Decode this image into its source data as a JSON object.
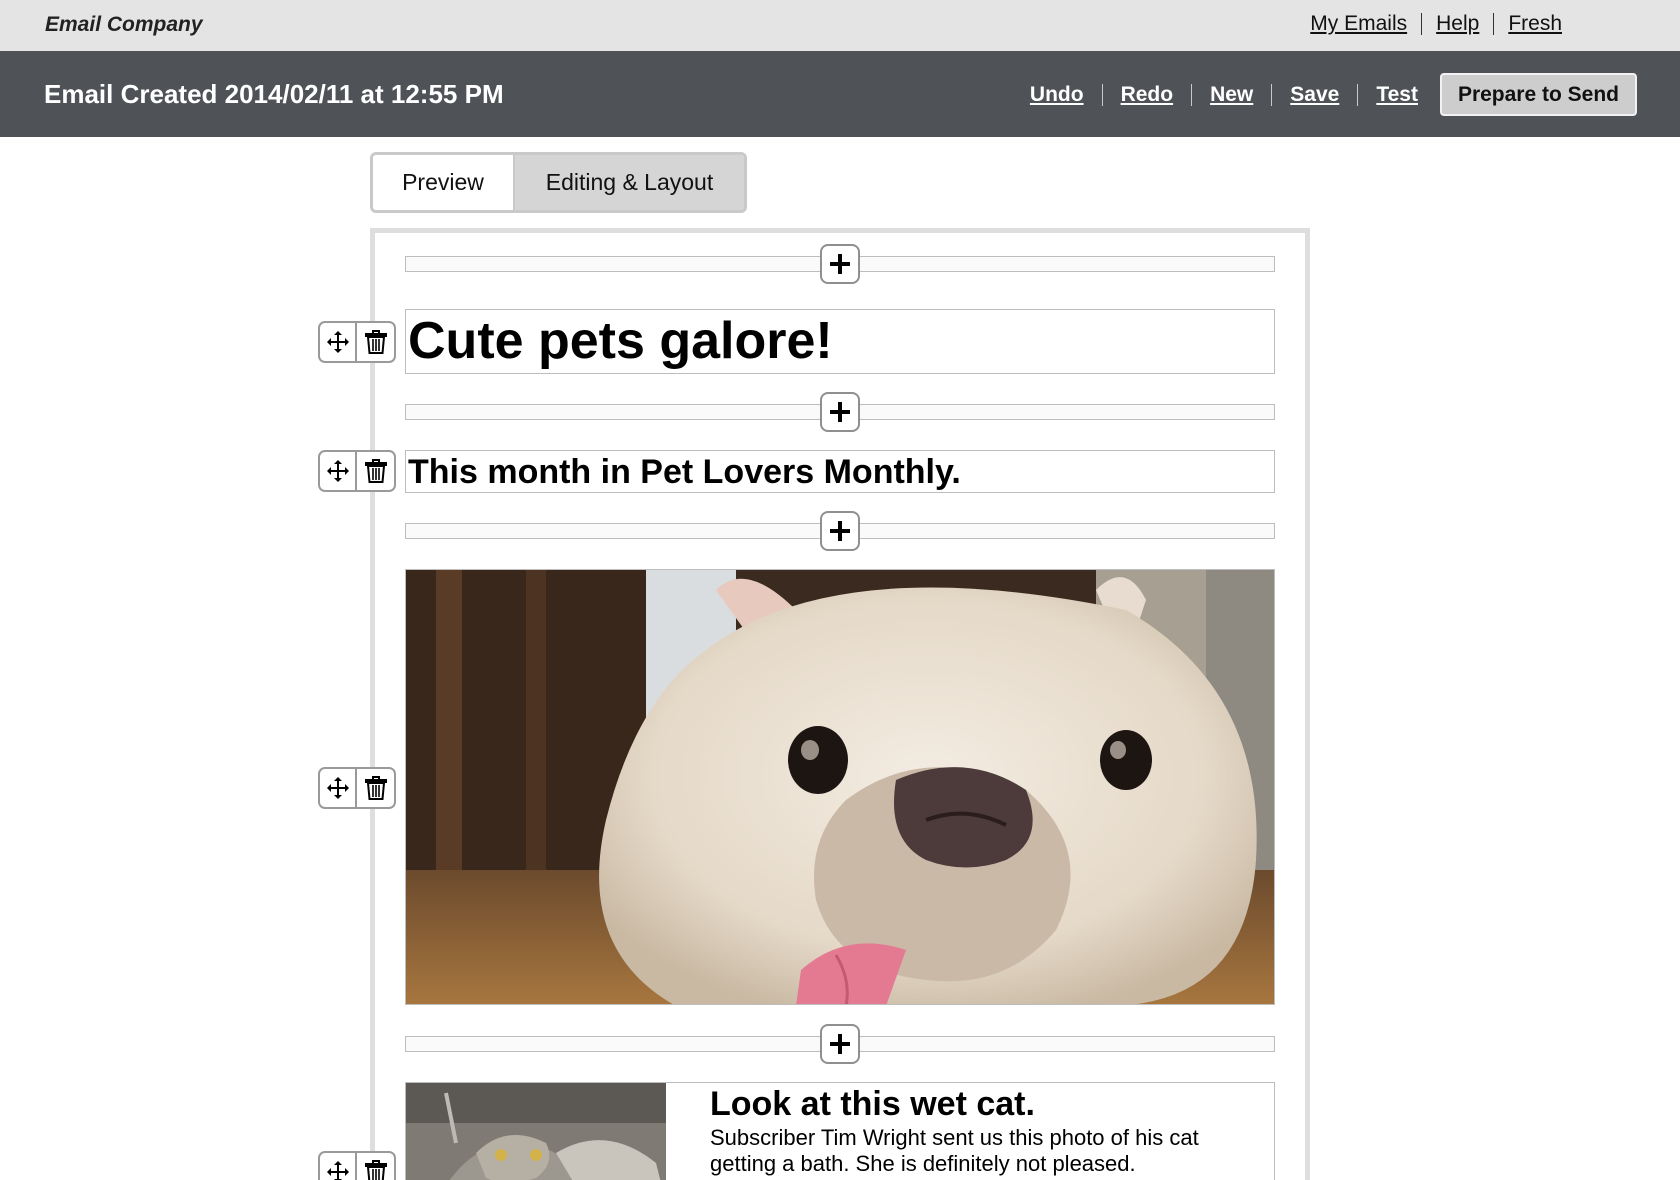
{
  "app": {
    "brand": "Email Company",
    "top_links": [
      "My Emails",
      "Help",
      "Fresh"
    ]
  },
  "header": {
    "title": "Email Created 2014/02/11 at 12:55 PM",
    "actions": [
      "Undo",
      "Redo",
      "New",
      "Save",
      "Test"
    ],
    "primary_button": "Prepare to Send"
  },
  "tabs": {
    "preview": "Preview",
    "editing": "Editing & Layout",
    "active": "Editing & Layout"
  },
  "email": {
    "heading": "Cute pets galore!",
    "subheading": "This month in Pet Lovers Monthly.",
    "hero_image": "french-bulldog-photo",
    "article": {
      "image": "wet-cat-photo",
      "title": "Look at this wet cat.",
      "body": "Subscriber Tim Wright sent us this photo of his cat getting a bath. She is definitely not pleased."
    }
  },
  "icons": {
    "add": "plus-icon",
    "move": "move-icon",
    "delete": "trash-icon"
  },
  "colors": {
    "topbar_bg": "#e4e4e5",
    "header_bg": "#4f5358",
    "button_bg": "#cdcdcd",
    "active_tab_bg": "#d5d5d5",
    "canvas_border": "#dedede"
  }
}
